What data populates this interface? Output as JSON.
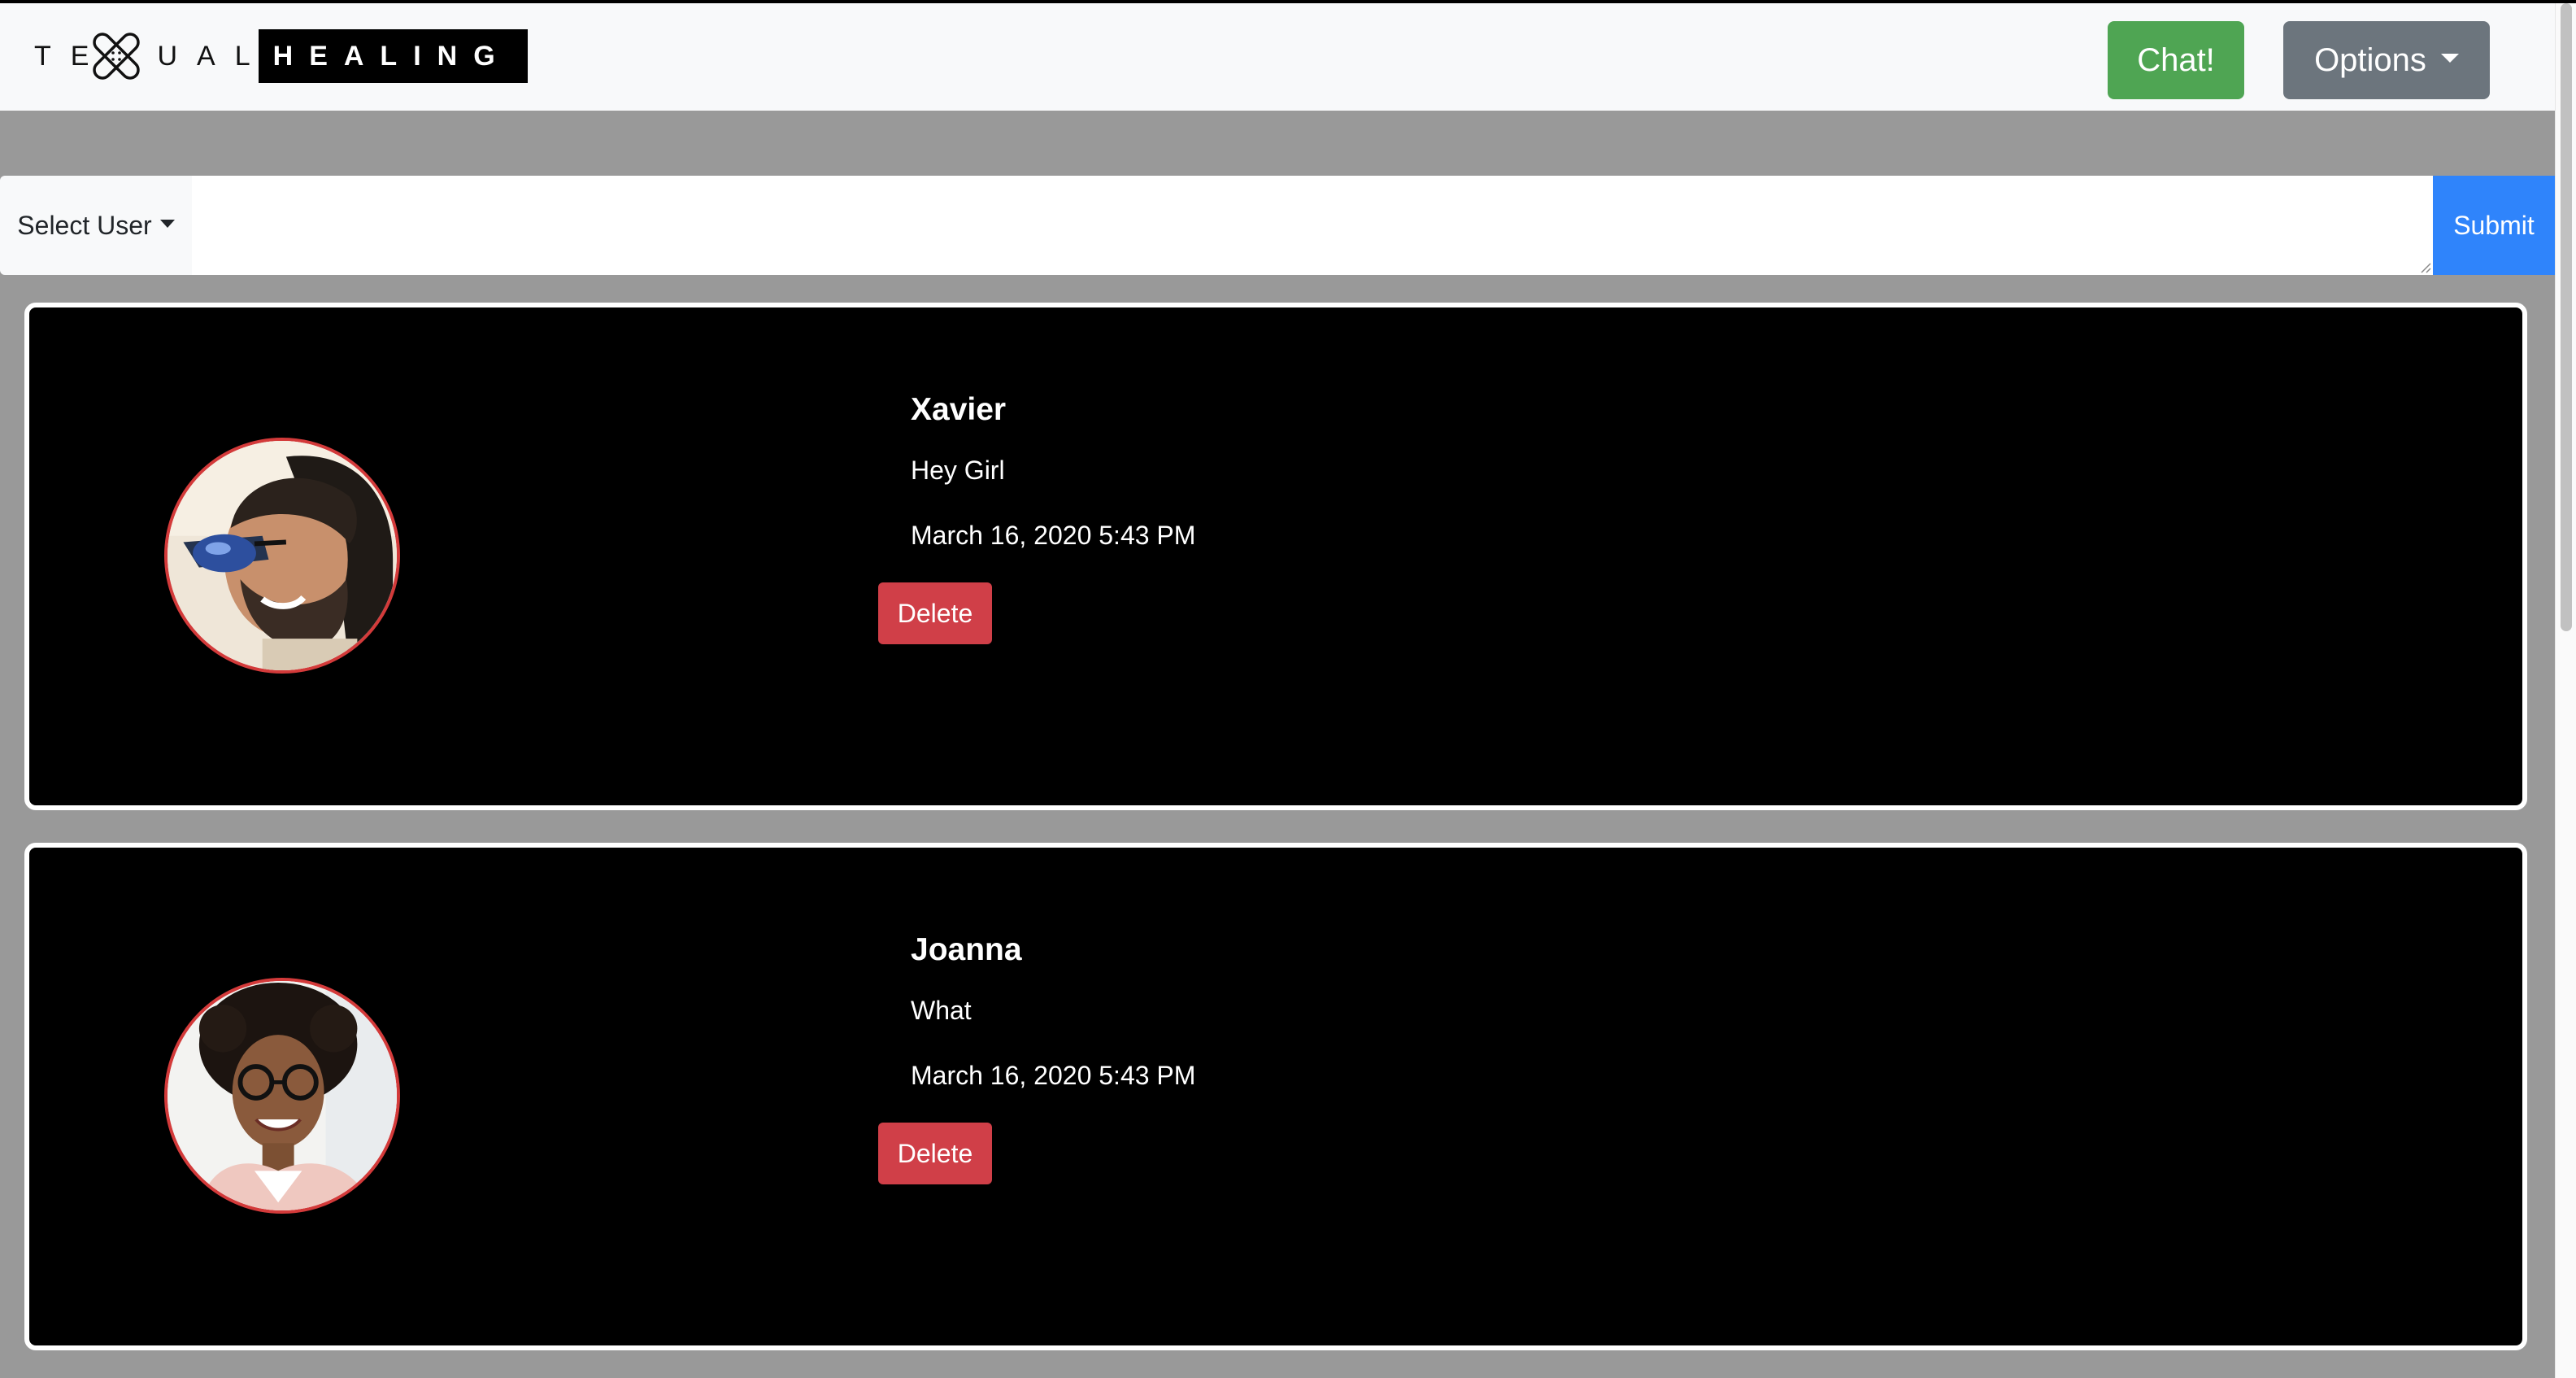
{
  "brand": {
    "left_letters": [
      "T",
      "E",
      "U",
      "A",
      "L"
    ],
    "right_text": "HEALING",
    "icon": "bandage-x-icon"
  },
  "nav": {
    "chat_label": "Chat!",
    "options_label": "Options"
  },
  "composer": {
    "select_label": "Select User",
    "input_value": "",
    "submit_label": "Submit"
  },
  "messages": [
    {
      "name": "Xavier",
      "text": "Hey Girl",
      "time": "March 16, 2020 5:43 PM",
      "delete_label": "Delete",
      "avatar": "man-with-sunglasses-photo"
    },
    {
      "name": "Joanna",
      "text": "What",
      "time": "March 16, 2020 5:43 PM",
      "delete_label": "Delete",
      "avatar": "woman-with-glasses-photo"
    }
  ],
  "colors": {
    "chat_button": "#4fa553",
    "options_button": "#6c757d",
    "submit_button": "#2f84fb",
    "delete_button": "#d03f48",
    "avatar_border": "#d33a3a",
    "page_background": "#999999"
  }
}
